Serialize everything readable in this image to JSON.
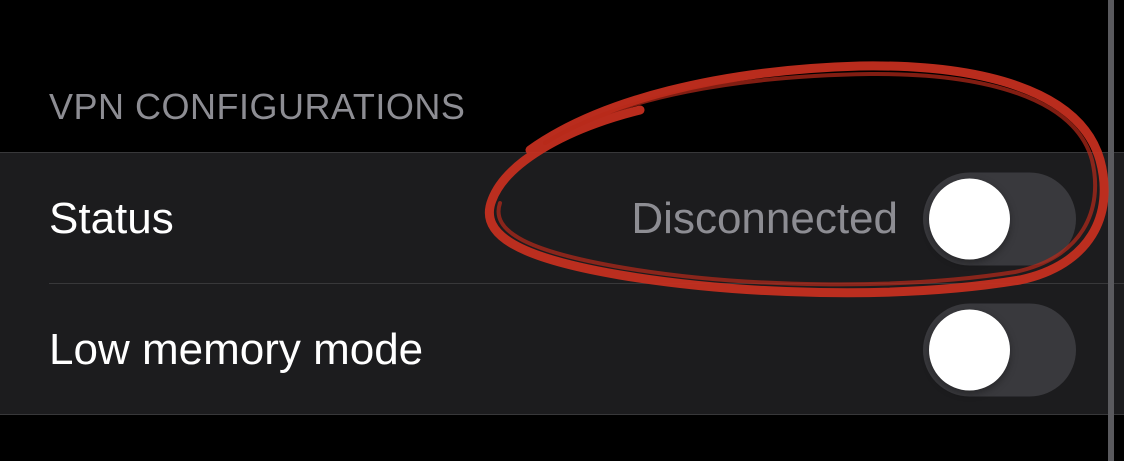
{
  "section": {
    "header": "VPN CONFIGURATIONS"
  },
  "rows": [
    {
      "label": "Status",
      "value": "Disconnected",
      "toggle_on": false
    },
    {
      "label": "Low memory mode",
      "toggle_on": false
    }
  ],
  "colors": {
    "background": "#000000",
    "group_background": "#1c1c1e",
    "secondary_text": "#8d8d93",
    "toggle_off_track": "#39393d",
    "annotation_stroke": "#c9301f"
  }
}
